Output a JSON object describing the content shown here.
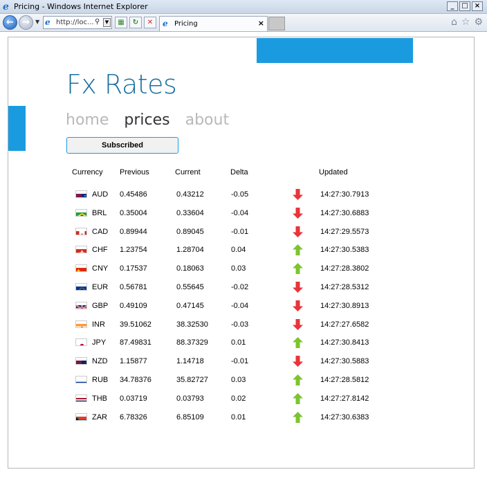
{
  "window": {
    "title": "Pricing - Windows Internet Explorer",
    "address": "http://loc...",
    "tab_title": "Pricing",
    "tab_close": "×"
  },
  "app": {
    "title": "Fx Rates",
    "nav": [
      "home",
      "prices",
      "about"
    ],
    "active_nav": "prices",
    "subscribe_label": "Subscribed",
    "accent_color": "#1a9be0",
    "title_color": "#1a6fa0",
    "up_color": "#7dc42e",
    "down_color": "#e8353b"
  },
  "table": {
    "headers": [
      "Currency",
      "Previous",
      "Current",
      "Delta",
      "Updated"
    ],
    "rows": [
      {
        "code": "AUD",
        "flag": "au-flag-icon",
        "previous": "0.45486",
        "current": "0.43212",
        "delta": "-0.05",
        "direction": "down",
        "updated": "14:27:30.7913"
      },
      {
        "code": "BRL",
        "flag": "br-flag-icon",
        "previous": "0.35004",
        "current": "0.33604",
        "delta": "-0.04",
        "direction": "down",
        "updated": "14:27:30.6883"
      },
      {
        "code": "CAD",
        "flag": "ca-flag-icon",
        "previous": "0.89944",
        "current": "0.89045",
        "delta": "-0.01",
        "direction": "down",
        "updated": "14:27:29.5573"
      },
      {
        "code": "CHF",
        "flag": "ch-flag-icon",
        "previous": "1.23754",
        "current": "1.28704",
        "delta": "0.04",
        "direction": "up",
        "updated": "14:27:30.5383"
      },
      {
        "code": "CNY",
        "flag": "cn-flag-icon",
        "previous": "0.17537",
        "current": "0.18063",
        "delta": "0.03",
        "direction": "up",
        "updated": "14:27:28.3802"
      },
      {
        "code": "EUR",
        "flag": "eu-flag-icon",
        "previous": "0.56781",
        "current": "0.55645",
        "delta": "-0.02",
        "direction": "down",
        "updated": "14:27:28.5312"
      },
      {
        "code": "GBP",
        "flag": "gb-flag-icon",
        "previous": "0.49109",
        "current": "0.47145",
        "delta": "-0.04",
        "direction": "down",
        "updated": "14:27:30.8913"
      },
      {
        "code": "INR",
        "flag": "in-flag-icon",
        "previous": "39.51062",
        "current": "38.32530",
        "delta": "-0.03",
        "direction": "down",
        "updated": "14:27:27.6582"
      },
      {
        "code": "JPY",
        "flag": "jp-flag-icon",
        "previous": "87.49831",
        "current": "88.37329",
        "delta": "0.01",
        "direction": "up",
        "updated": "14:27:30.8413"
      },
      {
        "code": "NZD",
        "flag": "nz-flag-icon",
        "previous": "1.15877",
        "current": "1.14718",
        "delta": "-0.01",
        "direction": "down",
        "updated": "14:27:30.5883"
      },
      {
        "code": "RUB",
        "flag": "ru-flag-icon",
        "previous": "34.78376",
        "current": "35.82727",
        "delta": "0.03",
        "direction": "up",
        "updated": "14:27:28.5812"
      },
      {
        "code": "THB",
        "flag": "th-flag-icon",
        "previous": "0.03719",
        "current": "0.03793",
        "delta": "0.02",
        "direction": "up",
        "updated": "14:27:27.8142"
      },
      {
        "code": "ZAR",
        "flag": "za-flag-icon",
        "previous": "6.78326",
        "current": "6.85109",
        "delta": "0.01",
        "direction": "up",
        "updated": "14:27:30.6383"
      }
    ]
  }
}
